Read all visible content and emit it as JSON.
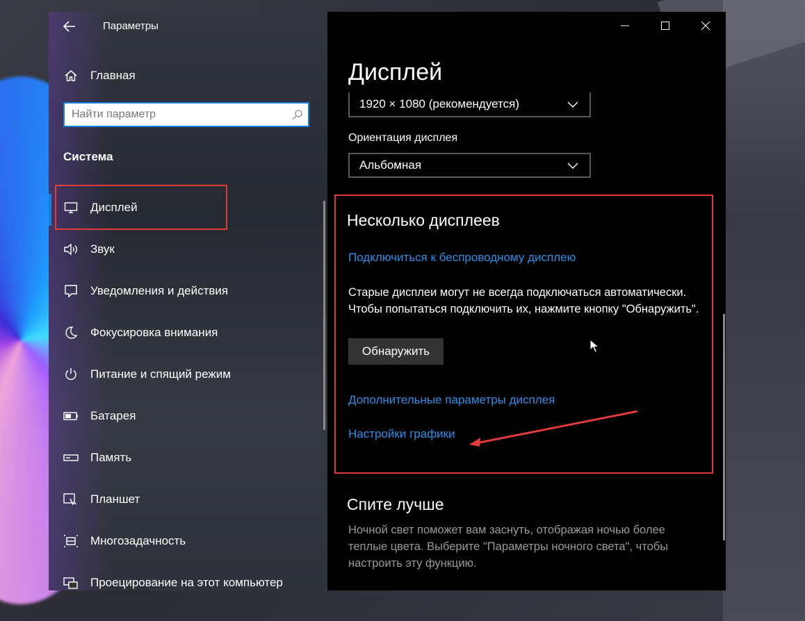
{
  "window": {
    "title": "Параметры",
    "controls": {
      "minimize": "—",
      "maximize": "☐",
      "close": "✕"
    }
  },
  "sidebar": {
    "home_label": "Главная",
    "search_placeholder": "Найти параметр",
    "section_title": "Система",
    "items": [
      {
        "label": "Дисплей",
        "icon": "monitor-icon",
        "active": true
      },
      {
        "label": "Звук",
        "icon": "speaker-icon"
      },
      {
        "label": "Уведомления и действия",
        "icon": "notification-icon"
      },
      {
        "label": "Фокусировка внимания",
        "icon": "moon-icon"
      },
      {
        "label": "Питание и спящий режим",
        "icon": "power-icon"
      },
      {
        "label": "Батарея",
        "icon": "battery-icon"
      },
      {
        "label": "Память",
        "icon": "storage-icon"
      },
      {
        "label": "Планшет",
        "icon": "tablet-icon"
      },
      {
        "label": "Многозадачность",
        "icon": "multitasking-icon"
      },
      {
        "label": "Проецирование на этот компьютер",
        "icon": "project-icon"
      }
    ]
  },
  "content": {
    "page_title": "Дисплей",
    "resolution_value": "1920 × 1080 (рекомендуется)",
    "orientation_label": "Ориентация дисплея",
    "orientation_value": "Альбомная",
    "multi_title": "Несколько дисплеев",
    "wireless_link": "Подключиться к беспроводному дисплею",
    "multi_desc": "Старые дисплеи могут не всегда подключаться автоматически. Чтобы попытаться подключить их, нажмите кнопку \"Обнаружить\".",
    "detect_button": "Обнаружить",
    "advanced_link": "Дополнительные параметры дисплея",
    "graphics_link": "Настройки графики",
    "sleep_title": "Спите лучше",
    "sleep_desc": "Ночной свет поможет вам заснуть, отображая ночью более теплые цвета. Выберите \"Параметры ночного света\", чтобы настроить эту функцию."
  },
  "colors": {
    "accent": "#1a7fdc",
    "link": "#2b8fe6",
    "annotation": "#e23b3b"
  }
}
